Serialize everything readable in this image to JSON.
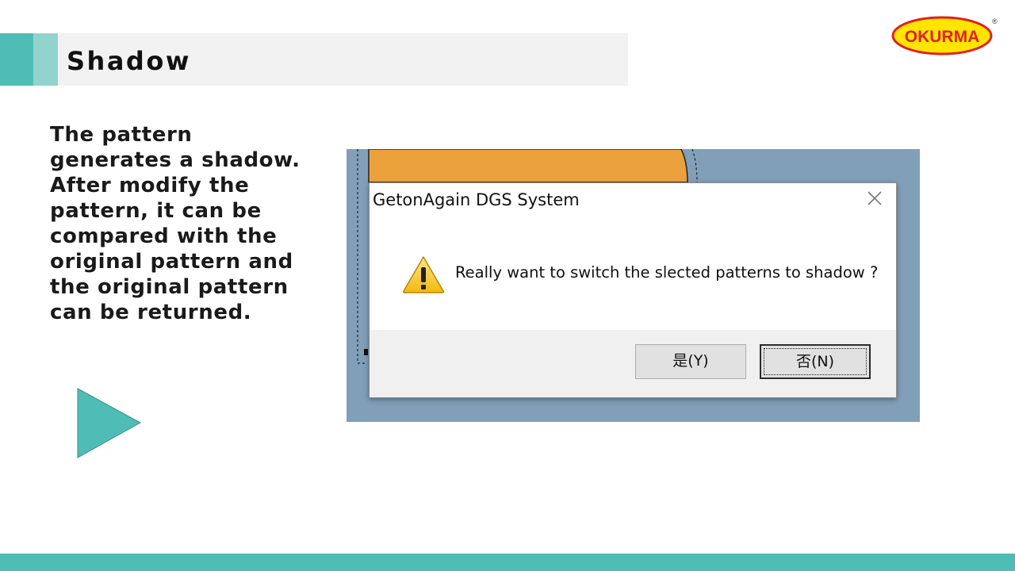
{
  "slide": {
    "title": "Shadow",
    "body": "The pattern generates a shadow. After modify the pattern, it can be compared with the original pattern and the original pattern can be returned.",
    "logo_text": "OKURMA",
    "logo_mark": "®"
  },
  "dialog": {
    "title": "GetonAgain DGS System",
    "message": "Really want to switch the slected patterns to shadow ?",
    "yes_label": "是(Y)",
    "no_label": "否(N)"
  },
  "colors": {
    "accent": "#4fbdb5",
    "accent_light": "#93d3cd",
    "logo_fill": "#ffe500",
    "logo_border": "#e02020",
    "screenshot_bg": "#819fb9",
    "pattern_orange": "#eca23c"
  },
  "icons": [
    "play-triangle-icon",
    "close-icon",
    "warning-icon"
  ]
}
